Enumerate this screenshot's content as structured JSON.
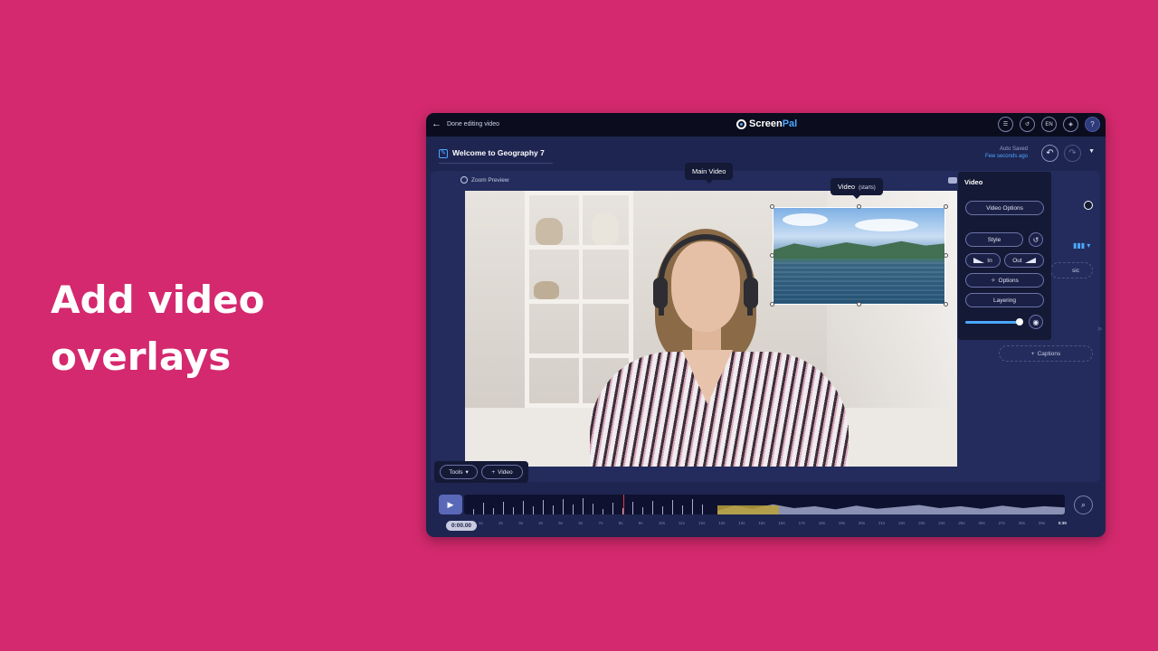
{
  "headline": {
    "line1": "Add video",
    "line2": "overlays"
  },
  "topbar": {
    "back_label": "Done editing video",
    "logo_main": "Screen",
    "logo_accent": "Pal",
    "icons": [
      "list-check-icon",
      "history-icon",
      "language-icon",
      "layers-icon",
      "help-icon"
    ],
    "language": "EN",
    "help": "?"
  },
  "titlebar": {
    "title": "Welcome to Geography 7",
    "autosave_status": "Auto Saved",
    "autosave_time": "Few seconds ago"
  },
  "preview": {
    "zoom_label": "Zoom Preview",
    "main_tooltip": "Main Video",
    "overlay_tooltip": "Video",
    "overlay_tooltip_sub": "(starts)"
  },
  "video_panel": {
    "title": "Video",
    "video_options": "Video Options",
    "style": "Style",
    "in": "In",
    "out": "Out",
    "options": "Options",
    "layering": "Layering",
    "opacity": 0.85
  },
  "side": {
    "music_fragment": "sic",
    "captions": "Captions"
  },
  "tools": {
    "tools_label": "Tools",
    "video_label": "Video"
  },
  "timeline": {
    "timecode": "0:00.00",
    "ticks": [
      "1s",
      "2s",
      "3s",
      "4s",
      "5s",
      "6s",
      "7s",
      "8s",
      "9s",
      "10s",
      "11s",
      "12s",
      "13s",
      "14s",
      "15s",
      "16s",
      "17s",
      "18s",
      "19s",
      "20s",
      "21s",
      "22s",
      "23s",
      "24s",
      "25s",
      "26s",
      "27s",
      "28s",
      "29s"
    ],
    "end_label": "0:30"
  },
  "colors": {
    "background": "#d4296e",
    "accent": "#4aa8ff",
    "app_bg": "#1e2550"
  }
}
